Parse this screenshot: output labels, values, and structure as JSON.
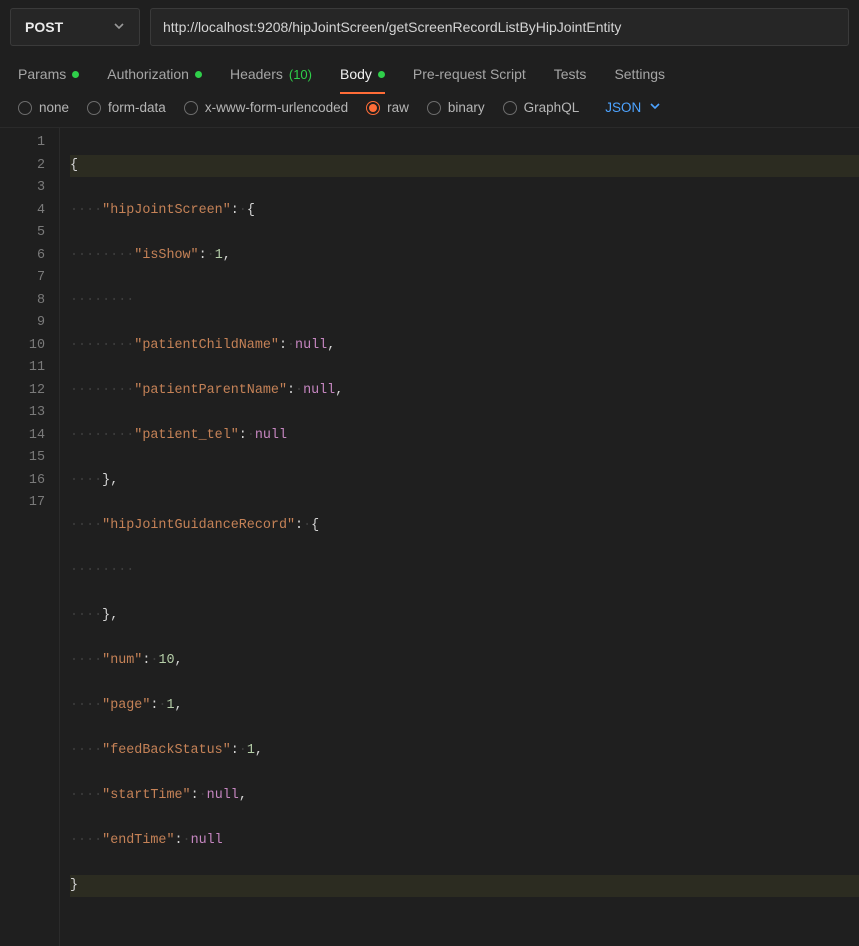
{
  "request": {
    "method": "POST",
    "url": "http://localhost:9208/hipJointScreen/getScreenRecordListByHipJointEntity"
  },
  "tabs": {
    "params": "Params",
    "authorization": "Authorization",
    "headers": "Headers",
    "headers_count": "(10)",
    "body": "Body",
    "prerequest": "Pre-request Script",
    "tests": "Tests",
    "settings": "Settings"
  },
  "body_options": {
    "none": "none",
    "formdata": "form-data",
    "xwww": "x-www-form-urlencoded",
    "raw": "raw",
    "binary": "binary",
    "graphql": "GraphQL",
    "lang": "JSON"
  },
  "editor": {
    "line_numbers": [
      "1",
      "2",
      "3",
      "4",
      "5",
      "6",
      "7",
      "8",
      "9",
      "10",
      "11",
      "12",
      "13",
      "14",
      "15",
      "16",
      "17"
    ],
    "tokens": {
      "k_hipJointScreen": "\"hipJointScreen\"",
      "k_isShow": "\"isShow\"",
      "k_patientChildName": "\"patientChildName\"",
      "k_patientParentName": "\"patientParentName\"",
      "k_patient_tel": "\"patient_tel\"",
      "k_hipJointGuidanceRecord": "\"hipJointGuidanceRecord\"",
      "k_num": "\"num\"",
      "k_page": "\"page\"",
      "k_feedBackStatus": "\"feedBackStatus\"",
      "k_startTime": "\"startTime\"",
      "k_endTime": "\"endTime\"",
      "v_1": "1",
      "v_10": "10",
      "v_null": "null"
    }
  }
}
